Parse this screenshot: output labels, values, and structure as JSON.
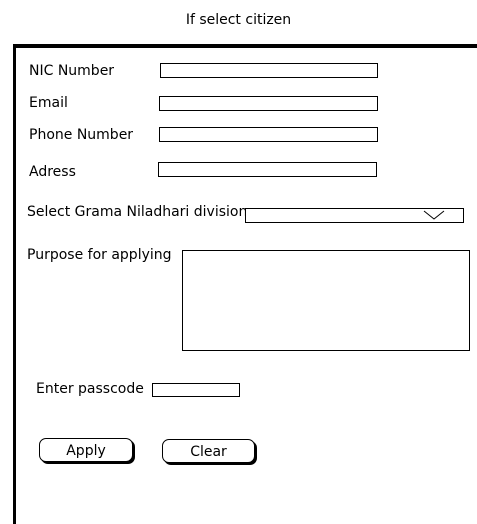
{
  "page": {
    "title": "If select citizen"
  },
  "form": {
    "nic_label": "NIC Number",
    "email_label": "Email",
    "phone_label": "Phone Number",
    "address_label": "Adress",
    "division_label": "Select Grama Niladhari division",
    "purpose_label": "Purpose for applying",
    "passcode_label": "Enter passcode"
  },
  "buttons": {
    "apply": "Apply",
    "clear": "Clear"
  },
  "icons": {
    "dropdown": "chevron-down-icon"
  }
}
